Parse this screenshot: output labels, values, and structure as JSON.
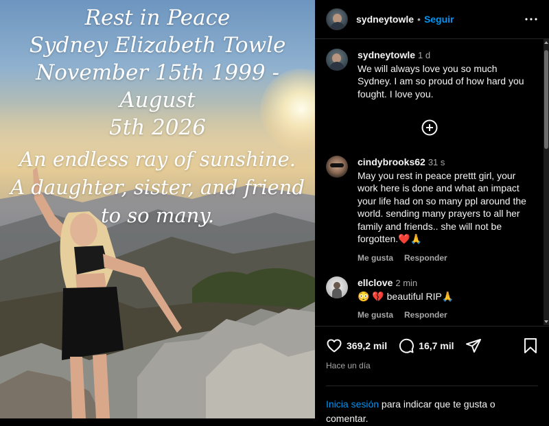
{
  "post": {
    "overlay_title_lines": [
      "Rest in Peace",
      "Sydney Elizabeth Towle",
      "November 15th 1999 - August",
      "5th 2026"
    ],
    "overlay_tagline_lines": [
      "An endless ray of sunshine.",
      "A daughter, sister, and friend",
      "to so many."
    ]
  },
  "header": {
    "username": "sydneytowle",
    "separator": "•",
    "follow_label": "Seguir",
    "more_icon": "more-horizontal-icon"
  },
  "comments": [
    {
      "username": "sydneytowle",
      "time": "1 d",
      "text": "We will always love you so much Sydney. I am so proud of how hard you fought. I love you."
    },
    {
      "username": "cindybrooks62",
      "time": "31 s",
      "text": "May you rest in peace prettt girl, your work here is done and what an impact your life had on so many ppl around the world. sending many prayers to all her family and friends.. she will not be forgotten.❤️🙏",
      "like_label": "Me gusta",
      "reply_label": "Responder"
    },
    {
      "username": "ellclove",
      "time": "2 min",
      "text": "😳 💔 beautiful RIP🙏",
      "like_label": "Me gusta",
      "reply_label": "Responder"
    }
  ],
  "actions": {
    "likes": "369,2 mil",
    "comments": "16,7 mil",
    "posted_ago": "Hace un día"
  },
  "login_prompt": {
    "link": "Inicia sesión",
    "text": " para indicar que te gusta o comentar."
  }
}
